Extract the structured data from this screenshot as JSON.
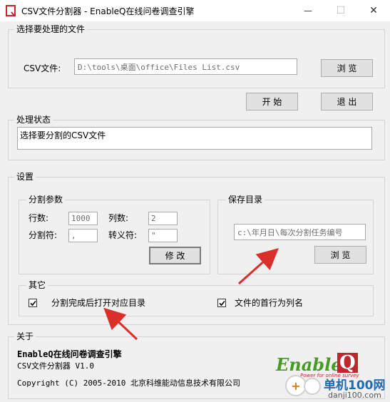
{
  "window": {
    "title": "CSV文件分割器 - EnableQ在线问卷调查引擎",
    "minimize": "—",
    "maximize": "☐",
    "close": "✕"
  },
  "file_group": {
    "title": "选择要处理的文件",
    "csv_label": "CSV文件:",
    "csv_value": "D:\\tools\\桌面\\office\\Files List.csv",
    "browse_label": "浏 览"
  },
  "actions": {
    "start_label": "开 始",
    "exit_label": "退 出"
  },
  "status_group": {
    "title": "处理状态",
    "text": "选择要分割的CSV文件"
  },
  "settings": {
    "title": "设置",
    "split": {
      "title": "分割参数",
      "rows_label": "行数:",
      "rows_value": "1000",
      "cols_label": "列数:",
      "cols_value": "2",
      "sep_label": "分割符:",
      "sep_value": ",",
      "escape_label": "转义符:",
      "escape_value": "\"",
      "modify_label": "修 改"
    },
    "save": {
      "title": "保存目录",
      "path_value": "c:\\年月日\\每次分割任务编号",
      "browse_label": "浏 览"
    },
    "other": {
      "title": "其它",
      "open_after_label": "分割完成后打开对应目录",
      "open_after_checked": true,
      "first_row_label": "文件的首行为列名",
      "first_row_checked": true
    }
  },
  "about": {
    "title": "关于",
    "product": "EnableQ在线问卷调查引擎",
    "version": "CSV文件分割器  V1.0",
    "copyright": "Copyright (C) 2005-2010 北京科维能动信息技术有限公司"
  },
  "logo": {
    "word_enable": "Enable",
    "word_q": "Q",
    "tagline": "Power for online survey"
  },
  "watermark": {
    "site_cn": "单机100网",
    "site_url": "danji100.com"
  },
  "colors": {
    "logo_green": "#4a9a2a",
    "logo_red": "#c0262d",
    "arrow_red": "#d9302c"
  }
}
